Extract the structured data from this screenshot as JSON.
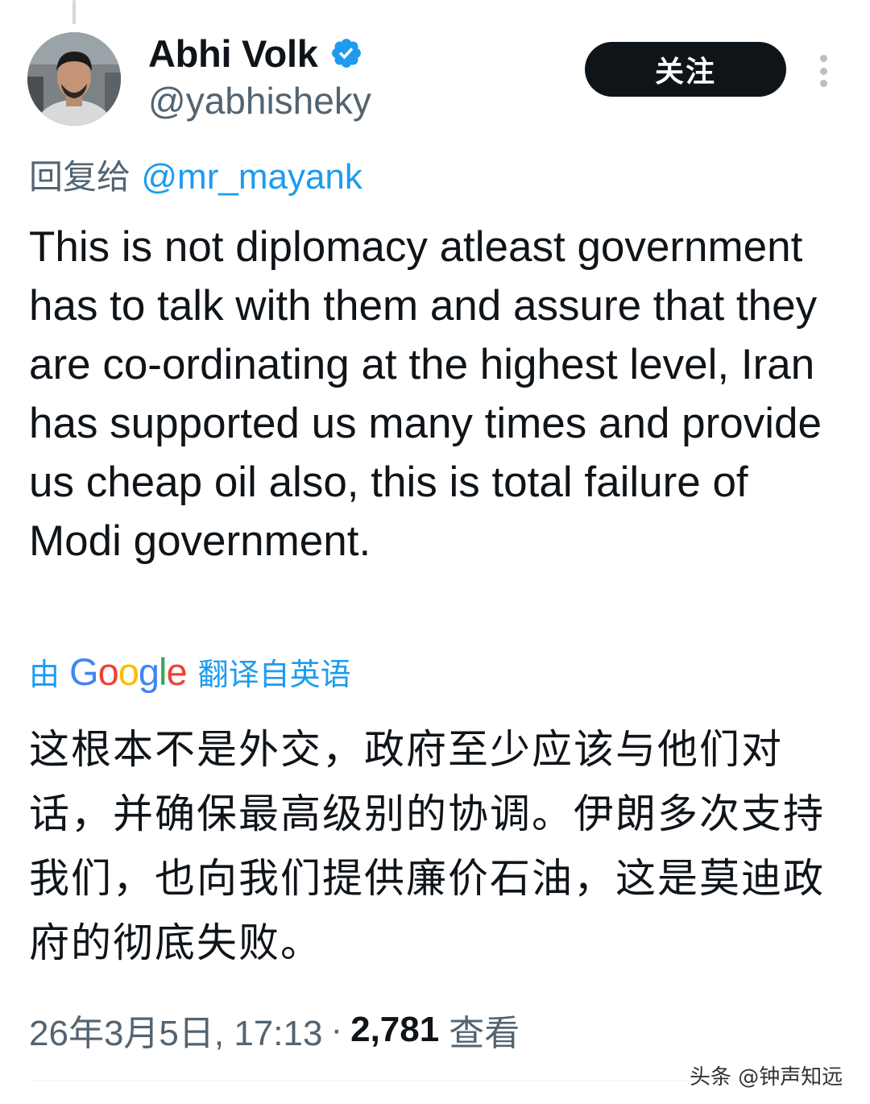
{
  "author": {
    "display_name": "Abhi Volk",
    "handle": "@yabhisheky",
    "avatar_icon": "profile-photo",
    "verified_icon": "verified-badge-icon"
  },
  "actions": {
    "follow_label": "关注",
    "more_icon": "more-vertical-icon"
  },
  "reply": {
    "prefix": "回复给",
    "mention": "@mr_mayank"
  },
  "tweet": {
    "text": "This is not diplomacy atleast government has to talk with them and assure that they are co-ordinating at the highest level, Iran has supported us many times and provide us cheap oil also, this is total failure of Modi government."
  },
  "translation": {
    "by": "由",
    "provider": "Google",
    "from": "翻译自英语",
    "text": "这根本不是外交，政府至少应该与他们对话，并确保最高级别的协调。伊朗多次支持我们，也向我们提供廉价石油，这是莫迪政府的彻底失败。"
  },
  "meta": {
    "datetime": "26年3月5日, 17:13",
    "separator": "·",
    "views_count": "2,781",
    "views_label": "查看"
  },
  "watermark": "头条 @钟声知远",
  "colors": {
    "link": "#1d9bf0",
    "secondary_text": "#536471",
    "primary_text": "#0f1419",
    "follow_button_bg": "#0f1419"
  }
}
